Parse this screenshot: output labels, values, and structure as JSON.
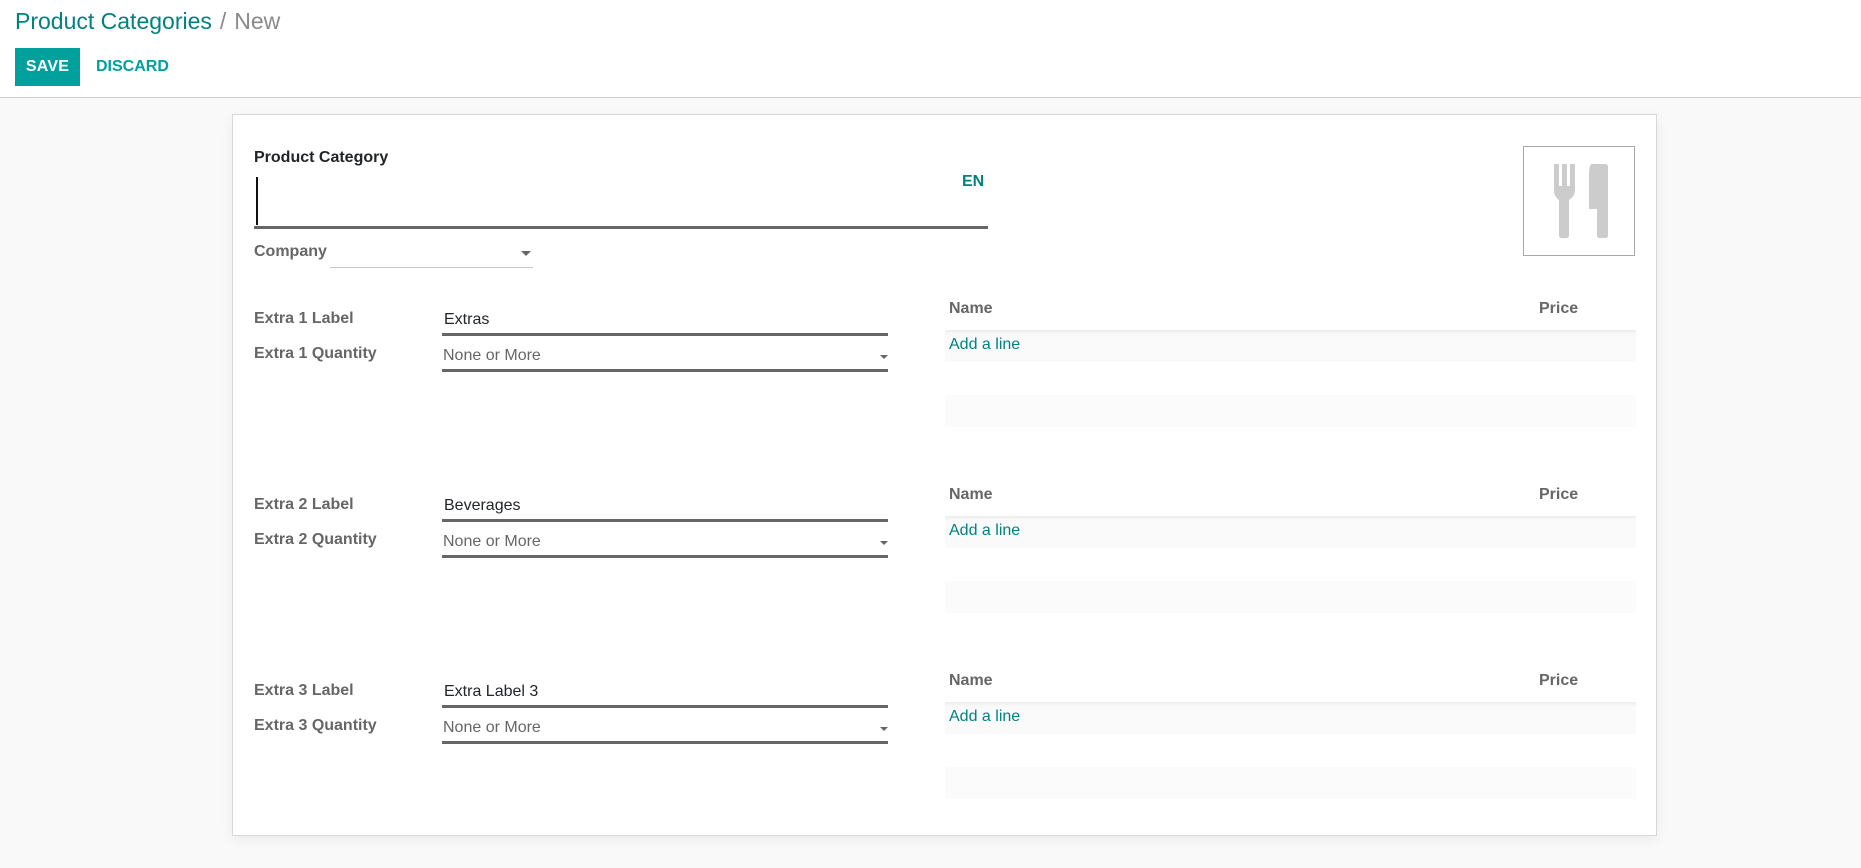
{
  "breadcrumb": {
    "parent": "Product Categories",
    "separator": "/",
    "current": "New"
  },
  "toolbar": {
    "save_label": "SAVE",
    "discard_label": "DISCARD"
  },
  "colors": {
    "primary": "#00a09d",
    "link": "#00827f"
  },
  "form": {
    "name_label": "Product Category",
    "name_value": "",
    "lang_label": "EN",
    "image_icon": "cutlery-icon",
    "company_label": "Company",
    "company_value": "",
    "extras": [
      {
        "label_field": "Extra 1 Label",
        "label_value": "Extras",
        "quantity_field": "Extra 1 Quantity",
        "quantity_value": "None or More",
        "lines": {
          "col_name": "Name",
          "col_price": "Price",
          "add_line": "Add a line"
        }
      },
      {
        "label_field": "Extra 2 Label",
        "label_value": "Beverages",
        "quantity_field": "Extra 2 Quantity",
        "quantity_value": "None or More",
        "lines": {
          "col_name": "Name",
          "col_price": "Price",
          "add_line": "Add a line"
        }
      },
      {
        "label_field": "Extra 3 Label",
        "label_value": "Extra Label 3",
        "quantity_field": "Extra 3 Quantity",
        "quantity_value": "None or More",
        "lines": {
          "col_name": "Name",
          "col_price": "Price",
          "add_line": "Add a line"
        }
      }
    ]
  }
}
